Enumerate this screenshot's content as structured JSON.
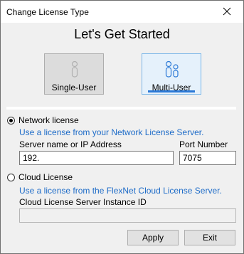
{
  "window": {
    "title": "Change License Type"
  },
  "heading": "Let's Get Started",
  "modes": {
    "single": {
      "label": "Single-User"
    },
    "multi": {
      "label": "Multi-User",
      "selected": true
    }
  },
  "network": {
    "label": "Network license",
    "hint": "Use a license from your Network License Server.",
    "server_label": "Server name or IP Address",
    "server_value": "192.",
    "port_label": "Port Number",
    "port_value": "7075",
    "checked": true
  },
  "cloud": {
    "label": "Cloud License",
    "hint": "Use a license from the FlexNet Cloud License Server.",
    "instance_label": "Cloud License Server Instance ID",
    "instance_value": "",
    "checked": false
  },
  "buttons": {
    "apply": "Apply",
    "exit": "Exit"
  },
  "colors": {
    "hint": "#1e6cc8",
    "accent": "#2b79d6"
  }
}
